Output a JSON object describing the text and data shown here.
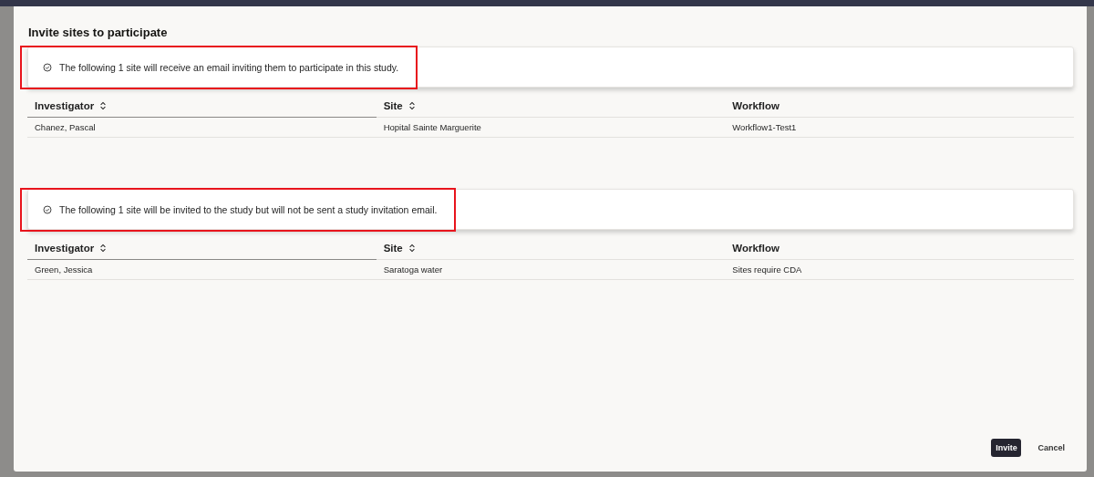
{
  "dialog": {
    "title": "Invite sites to participate",
    "sections": [
      {
        "message": {
          "text": "The following 1 site will receive an email inviting them to participate in this study.",
          "highlighted": true
        },
        "table": {
          "columns": [
            {
              "label": "Investigator",
              "sortable": true
            },
            {
              "label": "Site",
              "sortable": true
            },
            {
              "label": "Workflow",
              "sortable": false
            }
          ],
          "rows": [
            [
              "Chanez, Pascal",
              "Hopital Sainte Marguerite",
              "Workflow1-Test1"
            ]
          ]
        }
      },
      {
        "message": {
          "text": "The following 1 site will be invited to the study but will not be sent a study invitation email.",
          "highlighted": true
        },
        "table": {
          "columns": [
            {
              "label": "Investigator",
              "sortable": true
            },
            {
              "label": "Site",
              "sortable": true
            },
            {
              "label": "Workflow",
              "sortable": false
            }
          ],
          "rows": [
            [
              "Green, Jessica",
              "Saratoga water",
              "Sites require CDA"
            ]
          ]
        }
      }
    ],
    "buttons": [
      {
        "label": "Invite",
        "kind": "primary"
      },
      {
        "label": "Cancel",
        "kind": "secondary"
      }
    ]
  }
}
